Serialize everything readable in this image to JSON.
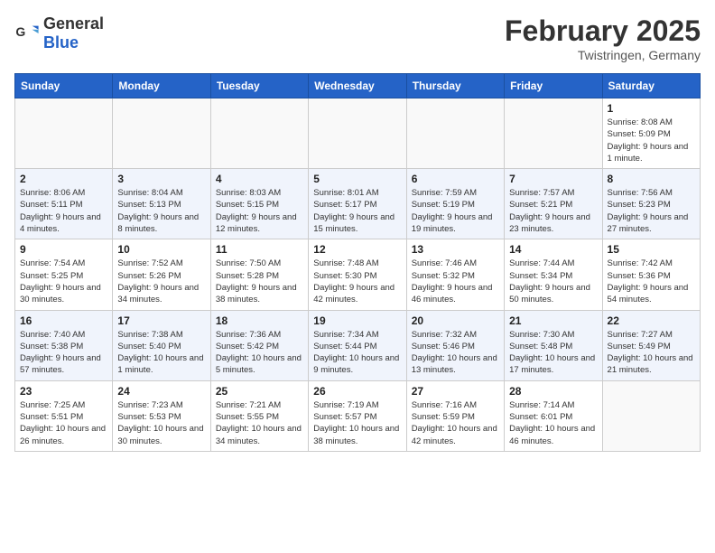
{
  "header": {
    "logo_general": "General",
    "logo_blue": "Blue",
    "month": "February 2025",
    "location": "Twistringen, Germany"
  },
  "weekdays": [
    "Sunday",
    "Monday",
    "Tuesday",
    "Wednesday",
    "Thursday",
    "Friday",
    "Saturday"
  ],
  "weeks": [
    [
      {
        "day": "",
        "info": ""
      },
      {
        "day": "",
        "info": ""
      },
      {
        "day": "",
        "info": ""
      },
      {
        "day": "",
        "info": ""
      },
      {
        "day": "",
        "info": ""
      },
      {
        "day": "",
        "info": ""
      },
      {
        "day": "1",
        "info": "Sunrise: 8:08 AM\nSunset: 5:09 PM\nDaylight: 9 hours and 1 minute."
      }
    ],
    [
      {
        "day": "2",
        "info": "Sunrise: 8:06 AM\nSunset: 5:11 PM\nDaylight: 9 hours and 4 minutes."
      },
      {
        "day": "3",
        "info": "Sunrise: 8:04 AM\nSunset: 5:13 PM\nDaylight: 9 hours and 8 minutes."
      },
      {
        "day": "4",
        "info": "Sunrise: 8:03 AM\nSunset: 5:15 PM\nDaylight: 9 hours and 12 minutes."
      },
      {
        "day": "5",
        "info": "Sunrise: 8:01 AM\nSunset: 5:17 PM\nDaylight: 9 hours and 15 minutes."
      },
      {
        "day": "6",
        "info": "Sunrise: 7:59 AM\nSunset: 5:19 PM\nDaylight: 9 hours and 19 minutes."
      },
      {
        "day": "7",
        "info": "Sunrise: 7:57 AM\nSunset: 5:21 PM\nDaylight: 9 hours and 23 minutes."
      },
      {
        "day": "8",
        "info": "Sunrise: 7:56 AM\nSunset: 5:23 PM\nDaylight: 9 hours and 27 minutes."
      }
    ],
    [
      {
        "day": "9",
        "info": "Sunrise: 7:54 AM\nSunset: 5:25 PM\nDaylight: 9 hours and 30 minutes."
      },
      {
        "day": "10",
        "info": "Sunrise: 7:52 AM\nSunset: 5:26 PM\nDaylight: 9 hours and 34 minutes."
      },
      {
        "day": "11",
        "info": "Sunrise: 7:50 AM\nSunset: 5:28 PM\nDaylight: 9 hours and 38 minutes."
      },
      {
        "day": "12",
        "info": "Sunrise: 7:48 AM\nSunset: 5:30 PM\nDaylight: 9 hours and 42 minutes."
      },
      {
        "day": "13",
        "info": "Sunrise: 7:46 AM\nSunset: 5:32 PM\nDaylight: 9 hours and 46 minutes."
      },
      {
        "day": "14",
        "info": "Sunrise: 7:44 AM\nSunset: 5:34 PM\nDaylight: 9 hours and 50 minutes."
      },
      {
        "day": "15",
        "info": "Sunrise: 7:42 AM\nSunset: 5:36 PM\nDaylight: 9 hours and 54 minutes."
      }
    ],
    [
      {
        "day": "16",
        "info": "Sunrise: 7:40 AM\nSunset: 5:38 PM\nDaylight: 9 hours and 57 minutes."
      },
      {
        "day": "17",
        "info": "Sunrise: 7:38 AM\nSunset: 5:40 PM\nDaylight: 10 hours and 1 minute."
      },
      {
        "day": "18",
        "info": "Sunrise: 7:36 AM\nSunset: 5:42 PM\nDaylight: 10 hours and 5 minutes."
      },
      {
        "day": "19",
        "info": "Sunrise: 7:34 AM\nSunset: 5:44 PM\nDaylight: 10 hours and 9 minutes."
      },
      {
        "day": "20",
        "info": "Sunrise: 7:32 AM\nSunset: 5:46 PM\nDaylight: 10 hours and 13 minutes."
      },
      {
        "day": "21",
        "info": "Sunrise: 7:30 AM\nSunset: 5:48 PM\nDaylight: 10 hours and 17 minutes."
      },
      {
        "day": "22",
        "info": "Sunrise: 7:27 AM\nSunset: 5:49 PM\nDaylight: 10 hours and 21 minutes."
      }
    ],
    [
      {
        "day": "23",
        "info": "Sunrise: 7:25 AM\nSunset: 5:51 PM\nDaylight: 10 hours and 26 minutes."
      },
      {
        "day": "24",
        "info": "Sunrise: 7:23 AM\nSunset: 5:53 PM\nDaylight: 10 hours and 30 minutes."
      },
      {
        "day": "25",
        "info": "Sunrise: 7:21 AM\nSunset: 5:55 PM\nDaylight: 10 hours and 34 minutes."
      },
      {
        "day": "26",
        "info": "Sunrise: 7:19 AM\nSunset: 5:57 PM\nDaylight: 10 hours and 38 minutes."
      },
      {
        "day": "27",
        "info": "Sunrise: 7:16 AM\nSunset: 5:59 PM\nDaylight: 10 hours and 42 minutes."
      },
      {
        "day": "28",
        "info": "Sunrise: 7:14 AM\nSunset: 6:01 PM\nDaylight: 10 hours and 46 minutes."
      },
      {
        "day": "",
        "info": ""
      }
    ]
  ]
}
